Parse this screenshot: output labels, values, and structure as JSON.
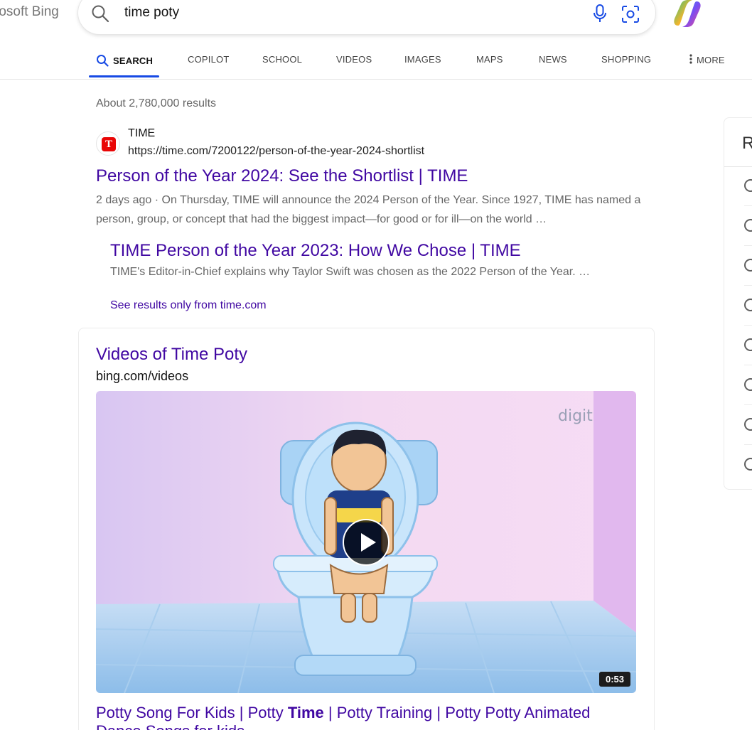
{
  "brand": "rosoft Bing",
  "search": {
    "query": "time poty"
  },
  "nav": {
    "tabs": [
      {
        "label": "SEARCH",
        "active": true
      },
      {
        "label": "COPILOT"
      },
      {
        "label": "SCHOOL"
      },
      {
        "label": "VIDEOS"
      },
      {
        "label": "IMAGES"
      },
      {
        "label": "MAPS"
      },
      {
        "label": "NEWS"
      },
      {
        "label": "SHOPPING"
      },
      {
        "label": "MORE"
      }
    ]
  },
  "results_count": "About 2,780,000 results",
  "result": {
    "site_name": "TIME",
    "favicon_letter": "T",
    "url": "https://time.com/7200122/person-of-the-year-2024-shortlist",
    "title": "Person of the Year 2024: See the Shortlist | TIME",
    "snippet": "2 days ago · On Thursday, TIME will announce the 2024 Person of the Year. Since 1927, TIME has named a person, group, or concept that had the biggest impact—for good or for ill—on the world …",
    "deep_link": {
      "title": "TIME Person of the Year 2023: How We Chose | TIME",
      "snippet": "TIME's Editor-in-Chief explains why Taylor Swift was chosen as the 2022 Person of the Year. …"
    },
    "see_more": "See results only from time.com"
  },
  "videos": {
    "heading": "Videos of Time Poty",
    "source": "bing.com/videos",
    "thumbnail": {
      "watermark": "digit",
      "duration": "0:53"
    },
    "title_parts": [
      "Potty Song For Kids | Potty ",
      "Time",
      " | Potty Training | Potty Potty Animated Dance Songs for kids"
    ]
  },
  "sidebar": {
    "heading": "R"
  },
  "colors": {
    "link": "#4007a2",
    "accent": "#174ae4",
    "favicon": "#e90606"
  }
}
